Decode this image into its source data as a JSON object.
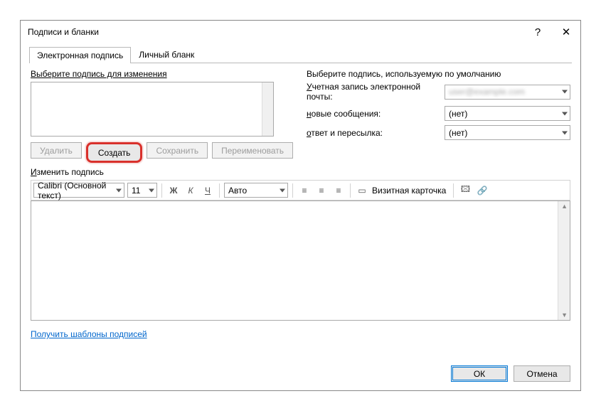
{
  "window": {
    "title": "Подписи и бланки",
    "help": "?",
    "close": "✕"
  },
  "tabs": {
    "signature": "Электронная подпись",
    "stationery": "Личный бланк"
  },
  "left": {
    "selectLabel": "Выберите подпись для изменения",
    "delete": "Удалить",
    "create": "Создать",
    "save": "Сохранить",
    "rename": "Переименовать"
  },
  "right": {
    "defaultLabel": "Выберите подпись, используемую по умолчанию",
    "accountLabel": "Учетная запись электронной почты:",
    "accountValue": "user@example.com",
    "newMsgLabel": "новые сообщения:",
    "newMsgValue": "(нет)",
    "replyLabel": "ответ и пересылка:",
    "replyValue": "(нет)"
  },
  "editor": {
    "editLabel": "Изменить подпись",
    "font": "Calibri (Основной текст)",
    "size": "11",
    "bold": "Ж",
    "italic": "К",
    "underline": "Ч",
    "color": "Авто",
    "card": "Визитная карточка"
  },
  "link": "Получить шаблоны подписей",
  "footer": {
    "ok": "ОК",
    "cancel": "Отмена"
  }
}
